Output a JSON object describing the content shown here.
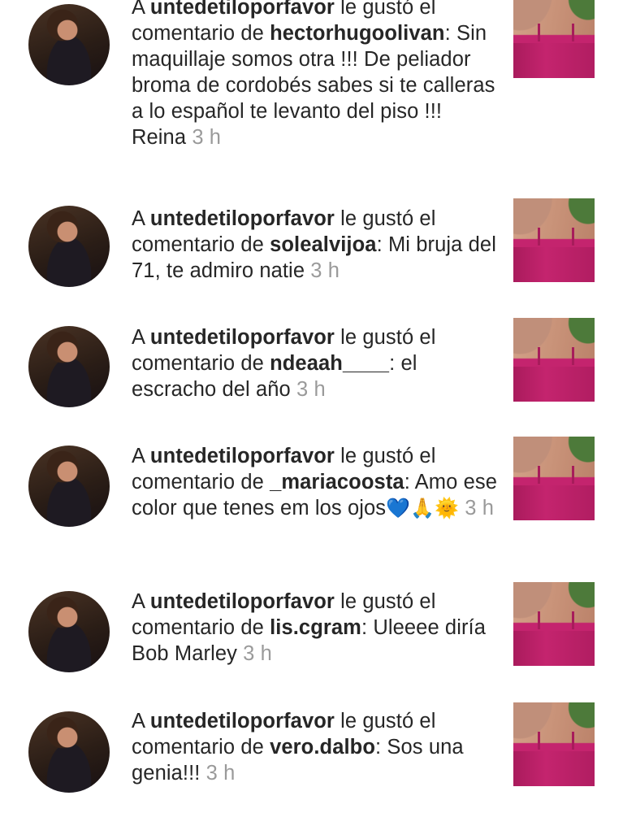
{
  "notifications": [
    {
      "liker": "untedetiloporfavor",
      "middle": " le gustó el comentario de ",
      "commenter": "hectorhugoolivan",
      "comment": ": Sin maquillaje somos otra !!! De peliador broma de cordobés sabes si te calleras a lo español te levanto del piso !!! Reina",
      "time": "3 h"
    },
    {
      "liker": "untedetiloporfavor",
      "middle": " le gustó el comentario de ",
      "commenter": "solealvijoa",
      "comment": ": Mi bruja del 71, te admiro natie",
      "time": "3 h"
    },
    {
      "liker": "untedetiloporfavor",
      "middle": " le gustó el comentario de ",
      "commenter": "ndeaah____",
      "comment": ": el escracho del año",
      "time": "3 h"
    },
    {
      "liker": "untedetiloporfavor",
      "middle": " le gustó el comentario de ",
      "commenter": "_mariacoosta",
      "comment": ": Amo ese color que tenes em los ojos",
      "emojis": [
        "💙",
        "🙏",
        "🌞"
      ],
      "time": "3 h"
    },
    {
      "liker": "untedetiloporfavor",
      "middle": " le gustó el comentario de ",
      "commenter": "lis.cgram",
      "comment": ": Uleeee diría Bob Marley",
      "time": "3 h"
    },
    {
      "liker": "untedetiloporfavor",
      "middle": " le gustó el comentario de ",
      "commenter": "vero.dalbo",
      "comment": ": Sos una genia!!!",
      "time": "3 h"
    }
  ],
  "icons": {
    "avatar": "user-avatar-photo",
    "thumbnail": "post-thumbnail-photo"
  },
  "colors": {
    "text": "#262626",
    "timestamp": "#9a9a9a",
    "background": "#ffffff"
  }
}
